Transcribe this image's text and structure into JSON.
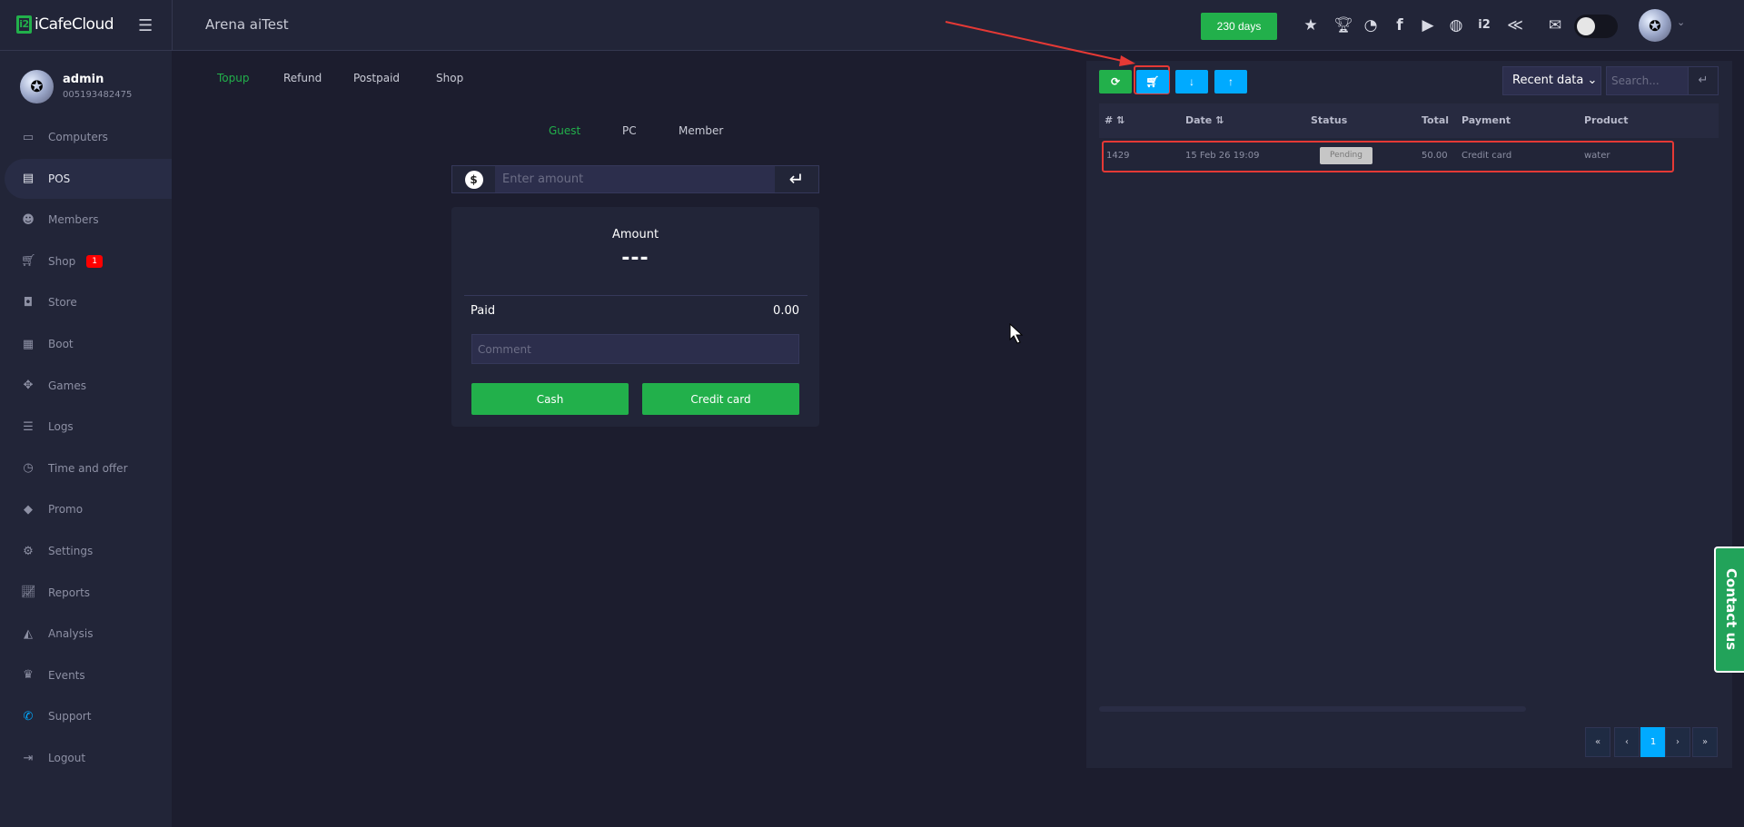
{
  "header": {
    "logo": "iCafeCloud",
    "logo_mark": "i2",
    "site": "Arena aiTest",
    "days": "230 days",
    "icons": [
      "ranking-icon",
      "trophy-icon",
      "rss-icon",
      "facebook-icon",
      "youtube-icon",
      "globe-icon",
      "icafe-icon",
      "partner-icon",
      "mail-icon"
    ]
  },
  "user": {
    "name": "admin",
    "id": "005193482475"
  },
  "sidebar": {
    "items": [
      {
        "label": "Computers",
        "icon": "monitor-icon"
      },
      {
        "label": "POS",
        "icon": "cash-register-icon"
      },
      {
        "label": "Members",
        "icon": "users-icon"
      },
      {
        "label": "Shop",
        "icon": "cart-icon",
        "badge": "1"
      },
      {
        "label": "Store",
        "icon": "bag-icon"
      },
      {
        "label": "Boot",
        "icon": "windows-icon"
      },
      {
        "label": "Games",
        "icon": "gamepad-icon"
      },
      {
        "label": "Logs",
        "icon": "list-icon"
      },
      {
        "label": "Time and offer",
        "icon": "stopwatch-icon"
      },
      {
        "label": "Promo",
        "icon": "tag-icon"
      },
      {
        "label": "Settings",
        "icon": "gear-icon"
      },
      {
        "label": "Reports",
        "icon": "chart-line-icon"
      },
      {
        "label": "Analysis",
        "icon": "chart-area-icon"
      },
      {
        "label": "Events",
        "icon": "crown-icon"
      },
      {
        "label": "Support",
        "icon": "phone-icon"
      },
      {
        "label": "Logout",
        "icon": "logout-icon"
      }
    ]
  },
  "tabs": [
    "Topup",
    "Refund",
    "Postpaid",
    "Shop"
  ],
  "subtabs": [
    "Guest",
    "PC",
    "Member"
  ],
  "topup": {
    "amount_placeholder": "Enter amount",
    "amount_label": "Amount",
    "amount_value": "---",
    "paid_label": "Paid",
    "paid_value": "0.00",
    "comment_placeholder": "Comment",
    "cash": "Cash",
    "credit": "Credit card"
  },
  "orders": {
    "filter": "Recent data",
    "search_placeholder": "Search...",
    "columns": [
      "#",
      "Date",
      "Status",
      "Total",
      "Payment",
      "Product"
    ],
    "rows": [
      {
        "id": "1429",
        "date": "15 Feb 26 19:09",
        "status": "Pending",
        "total": "50.00",
        "payment": "Credit card",
        "product": "water"
      }
    ],
    "pagination": [
      "«",
      "‹",
      "1",
      "›",
      "»"
    ]
  },
  "contact": "Contact us",
  "colors": {
    "accent_green": "#22b04b",
    "accent_blue": "#00aaff",
    "highlight_red": "#e53935"
  }
}
